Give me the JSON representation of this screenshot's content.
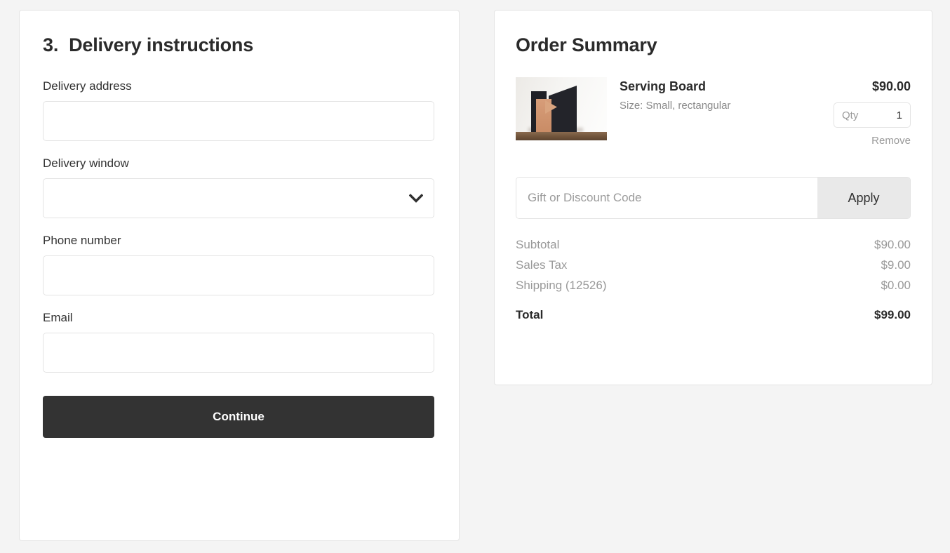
{
  "delivery": {
    "step_number": "3.",
    "title": "Delivery instructions",
    "fields": [
      {
        "label": "Delivery address",
        "value": "",
        "placeholder": ""
      },
      {
        "label": "Delivery window",
        "value": "",
        "placeholder": ""
      },
      {
        "label": "Phone number",
        "value": "",
        "placeholder": ""
      },
      {
        "label": "Email",
        "value": "",
        "placeholder": ""
      }
    ],
    "continue_label": "Continue",
    "chevron_icon": "chevron-down-icon"
  },
  "summary": {
    "title": "Order Summary",
    "item": {
      "name": "Serving Board",
      "variant": "Size: Small, rectangular",
      "price": "$90.00",
      "qty_label": "Qty",
      "qty_value": "1",
      "remove_label": "Remove",
      "image_alt": "serving-board-photo"
    },
    "promo": {
      "placeholder": "Gift or Discount Code",
      "value": "",
      "apply_label": "Apply"
    },
    "totals": [
      {
        "label": "Subtotal",
        "value": "$90.00"
      },
      {
        "label": "Sales Tax",
        "value": "$9.00"
      },
      {
        "label": "Shipping (12526)",
        "value": "$0.00"
      }
    ],
    "grand_total": {
      "label": "Total",
      "value": "$99.00"
    }
  },
  "colors": {
    "page_bg": "#f4f4f4",
    "panel_bg": "#ffffff",
    "border": "#e4e4e4",
    "button_dark": "#333333",
    "apply_bg": "#e9e9e9",
    "muted_text": "#999999"
  }
}
